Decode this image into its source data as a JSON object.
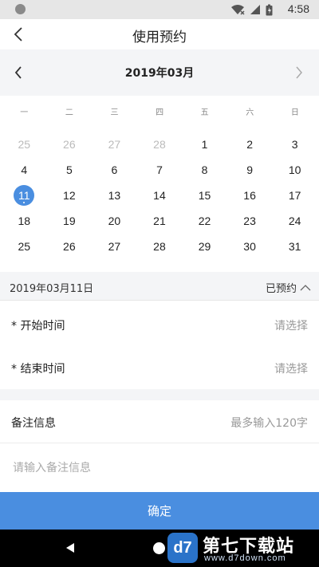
{
  "status": {
    "time": "4:58"
  },
  "header": {
    "title": "使用预约"
  },
  "calendar": {
    "month_label": "2019年03月",
    "weekdays": [
      "一",
      "二",
      "三",
      "四",
      "五",
      "六",
      "日"
    ],
    "weeks": [
      [
        "25",
        "26",
        "27",
        "28",
        "1",
        "2",
        "3"
      ],
      [
        "4",
        "5",
        "6",
        "7",
        "8",
        "9",
        "10"
      ],
      [
        "11",
        "12",
        "13",
        "14",
        "15",
        "16",
        "17"
      ],
      [
        "18",
        "19",
        "20",
        "21",
        "22",
        "23",
        "24"
      ],
      [
        "25",
        "26",
        "27",
        "28",
        "29",
        "30",
        "31"
      ]
    ],
    "selected_day": "11"
  },
  "selection": {
    "date": "2019年03月11日",
    "status": "已预约"
  },
  "form": {
    "start_label": "* 开始时间",
    "start_value": "请选择",
    "end_label": "* 结束时间",
    "end_value": "请选择",
    "remark_label": "备注信息",
    "remark_hint": "最多输入120字",
    "remark_placeholder": "请输入备注信息"
  },
  "actions": {
    "confirm": "确定"
  },
  "watermark": {
    "logo": "d7",
    "name": "第七下载站",
    "url": "www.d7down.com"
  },
  "colors": {
    "accent": "#4a8ee0",
    "background_gray": "#f4f5f7"
  }
}
